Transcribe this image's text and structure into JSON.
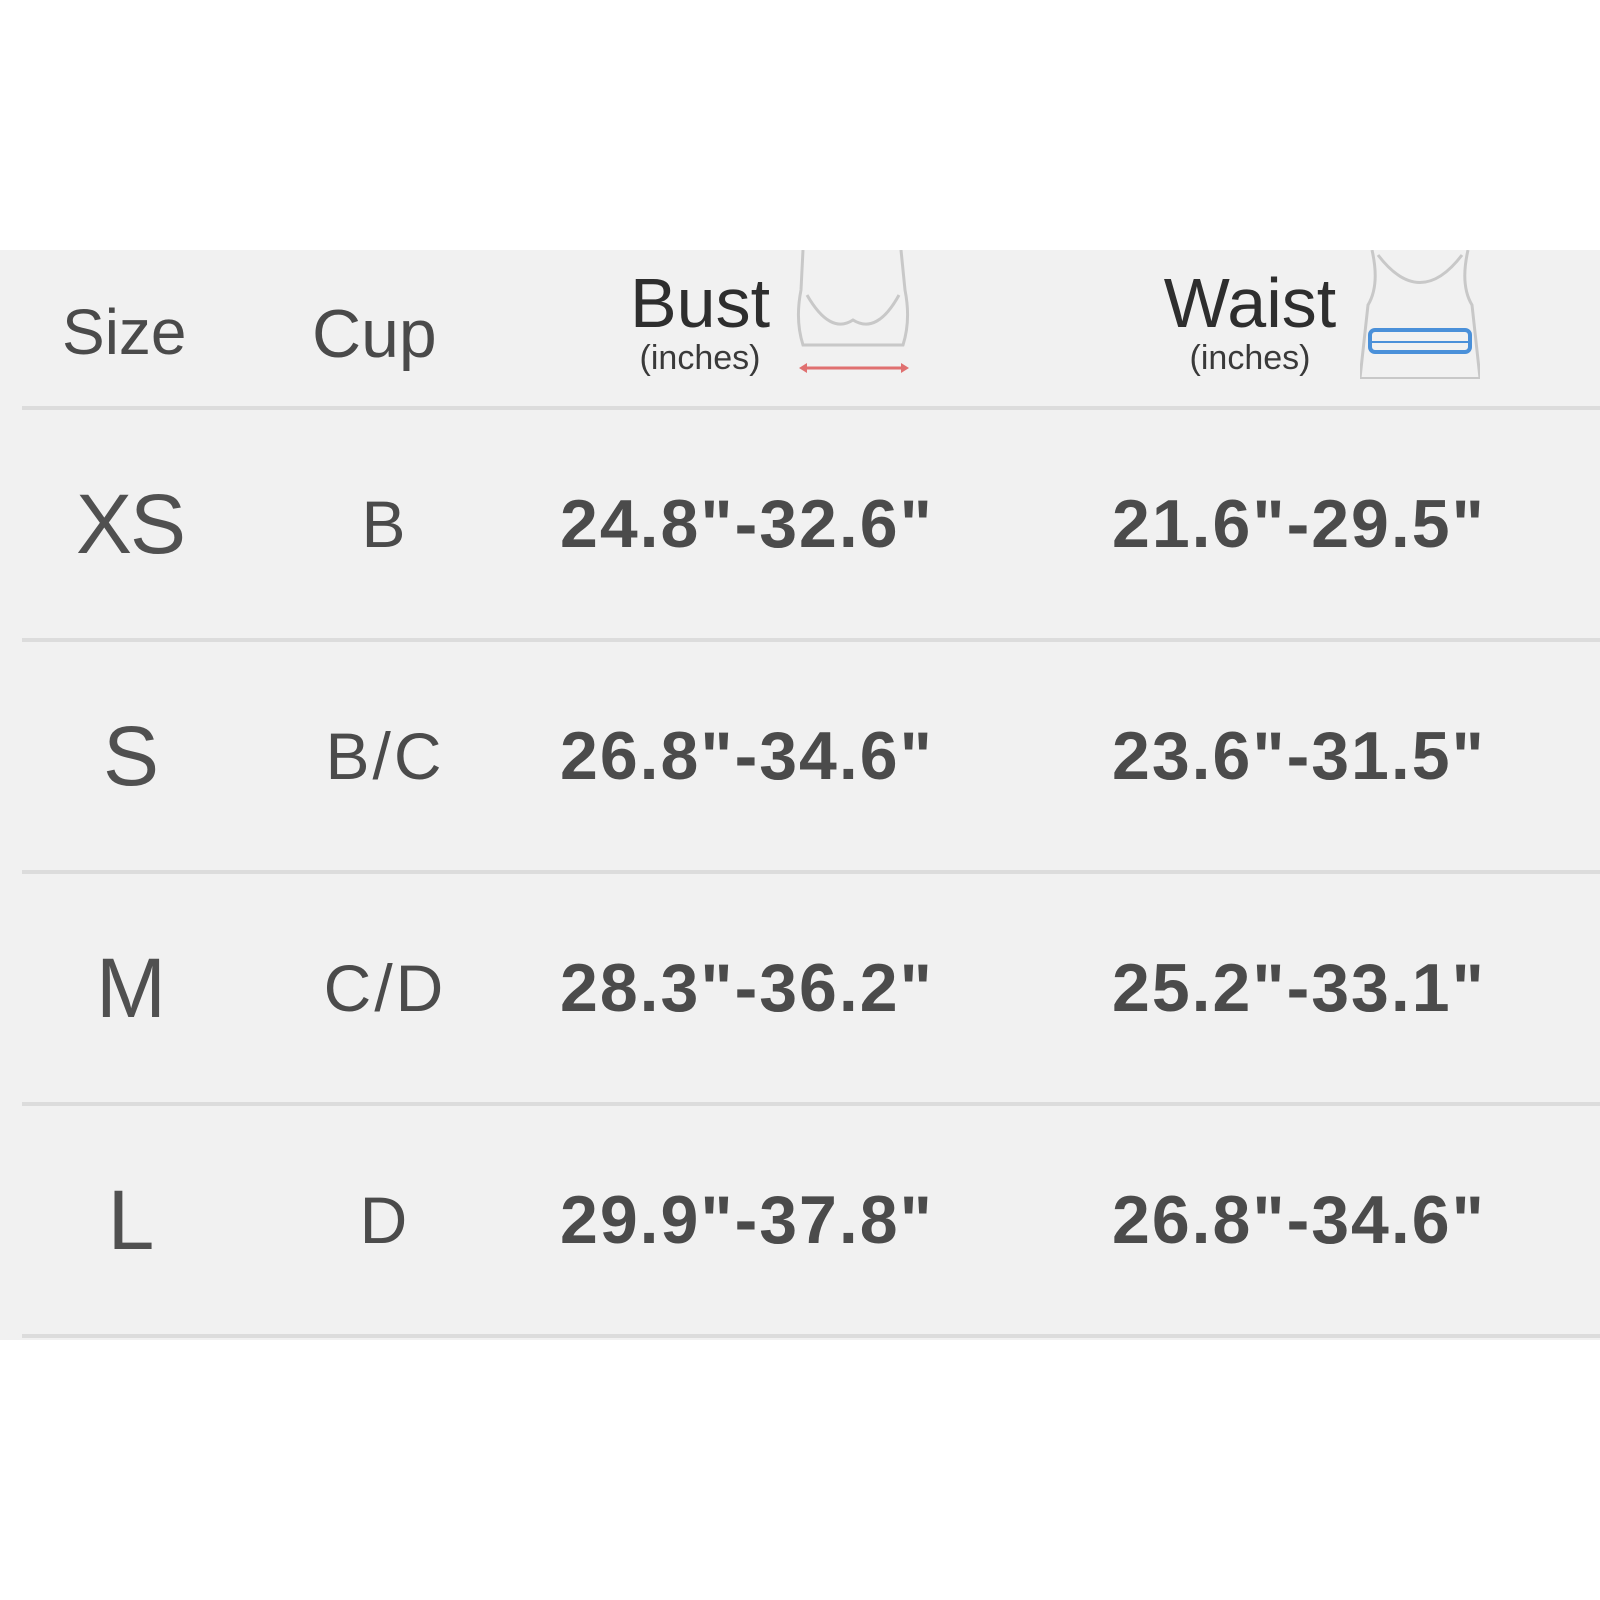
{
  "header": {
    "size": "Size",
    "cup": "Cup",
    "bust": "Bust",
    "bust_unit": "(inches)",
    "waist": "Waist",
    "waist_unit": "(inches)"
  },
  "rows": [
    {
      "size": "XS",
      "cup": "B",
      "bust": "24.8\"-32.6\"",
      "waist": "21.6\"-29.5\""
    },
    {
      "size": "S",
      "cup": "B/C",
      "bust": "26.8\"-34.6\"",
      "waist": "23.6\"-31.5\""
    },
    {
      "size": "M",
      "cup": "C/D",
      "bust": "28.3\"-36.2\"",
      "waist": "25.2\"-33.1\""
    },
    {
      "size": "L",
      "cup": "D",
      "bust": "29.9\"-37.8\"",
      "waist": "26.8\"-34.6\""
    }
  ],
  "icons": {
    "bust": "bra-bust-measure-icon",
    "waist": "tank-waist-measure-icon"
  },
  "colors": {
    "bust_measure": "#e07070",
    "waist_measure": "#4a90d9"
  }
}
